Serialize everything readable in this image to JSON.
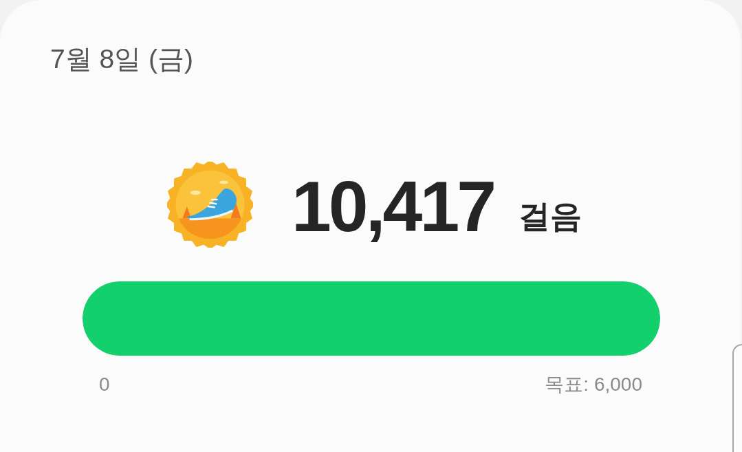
{
  "date": "7월 8일 (금)",
  "steps": {
    "value": "10,417",
    "unit": "걸음"
  },
  "progress": {
    "level": 1,
    "min_label": "0",
    "goal_label": "목표: 6,000"
  }
}
